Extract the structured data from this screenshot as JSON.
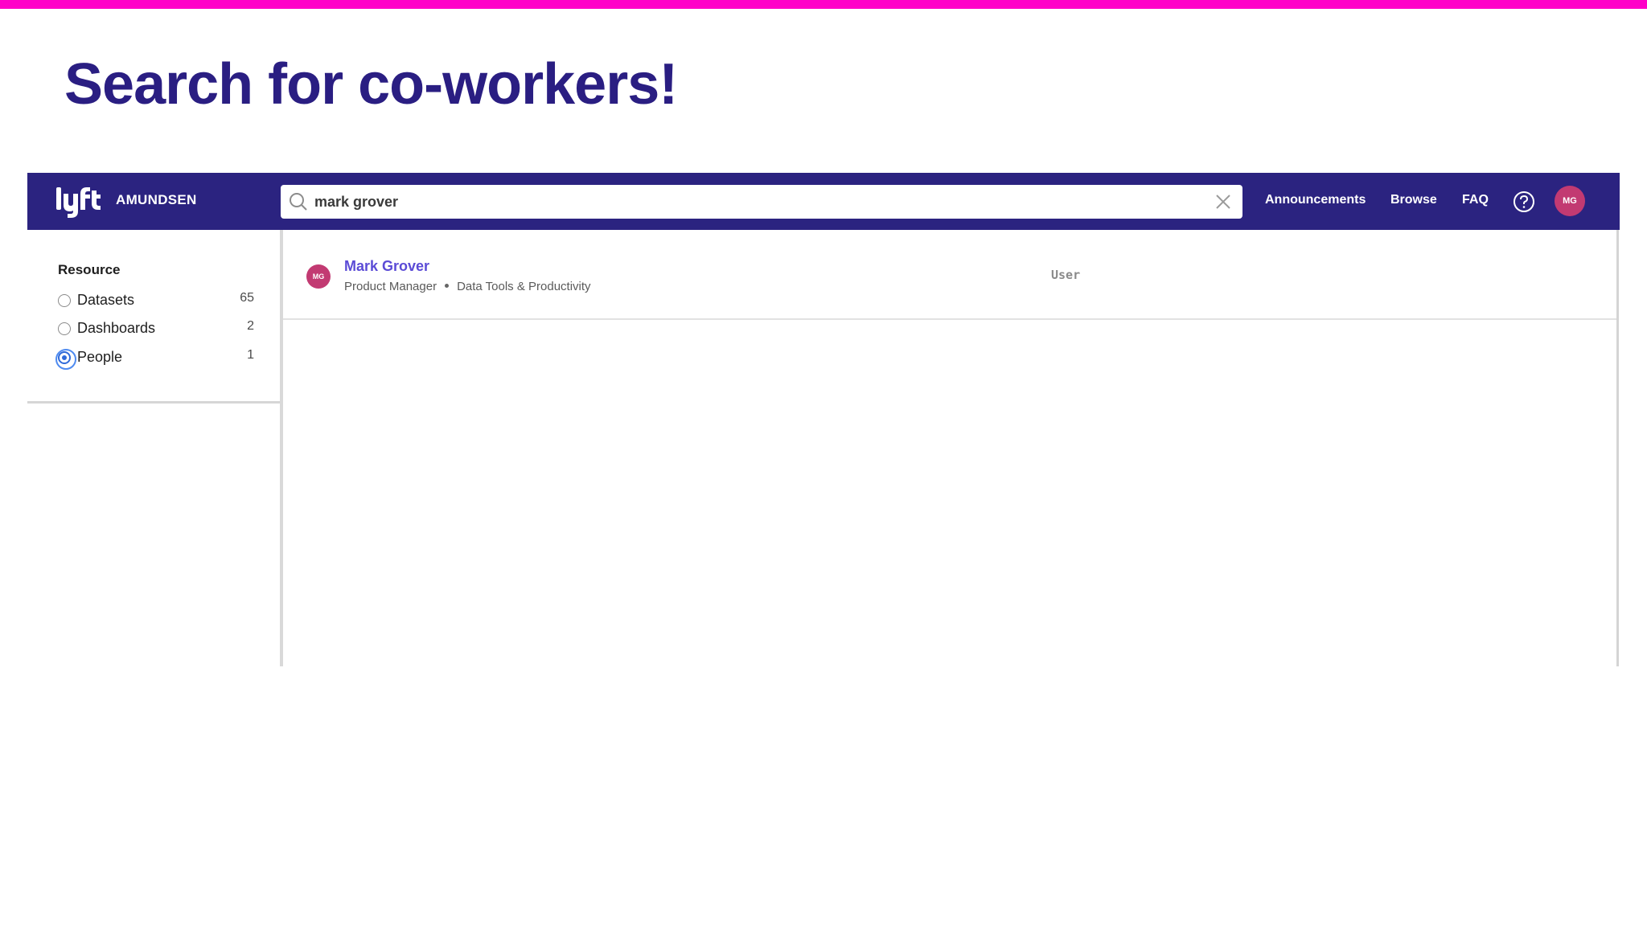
{
  "colors": {
    "stripe": "#ff00c8",
    "title": "#2a1e82",
    "navbar": "#2b2380",
    "link": "#5b4bd6",
    "avatar": "#c23a72"
  },
  "slide": {
    "title": "Search for co-workers!"
  },
  "navbar": {
    "logo_icon": "lyft-logo-icon",
    "brand": "AMUNDSEN",
    "search": {
      "value": "mark grover",
      "icon": "search-icon",
      "clear_icon": "close-icon"
    },
    "links": [
      "Announcements",
      "Browse",
      "FAQ"
    ],
    "help_icon": "question-circle-icon",
    "avatar_initials": "MG"
  },
  "sidebar": {
    "section_title": "Resource",
    "filters": [
      {
        "label": "Datasets",
        "count": "65",
        "selected": false
      },
      {
        "label": "Dashboards",
        "count": "2",
        "selected": false
      },
      {
        "label": "People",
        "count": "1",
        "selected": true
      }
    ]
  },
  "results": [
    {
      "avatar_initials": "MG",
      "name": "Mark Grover",
      "role": "Product Manager",
      "team": "Data Tools & Productivity",
      "type": "User"
    }
  ]
}
